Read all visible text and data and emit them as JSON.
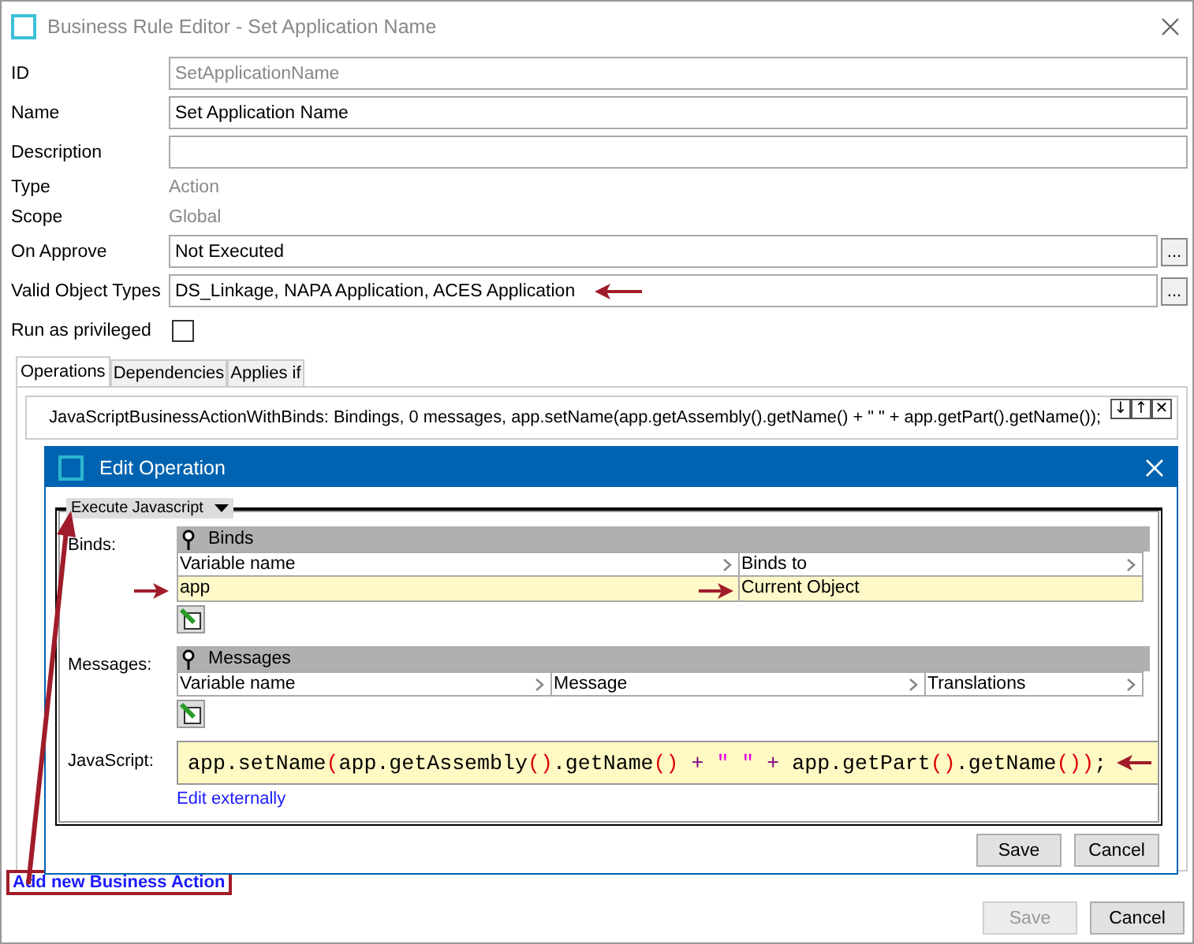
{
  "window": {
    "title": "Business Rule Editor - Set Application Name"
  },
  "fields": [
    {
      "label": "ID",
      "kind": "readonly",
      "value": "SetApplicationName"
    },
    {
      "label": "Name",
      "kind": "input",
      "value": "Set Application Name"
    },
    {
      "label": "Description",
      "kind": "input"
    },
    {
      "label": "Type",
      "kind": "text",
      "value": "Action"
    },
    {
      "label": "Scope",
      "kind": "text",
      "value": "Global"
    },
    {
      "label": "On Approve",
      "kind": "picker",
      "value": "Not Executed",
      "button": "..."
    },
    {
      "label": "Valid Object Types",
      "kind": "picker",
      "value": "DS_Linkage, NAPA Application, ACES Application",
      "button": "...",
      "annotated": true
    },
    {
      "label": "Run as privileged",
      "kind": "checkbox",
      "checked": false
    }
  ],
  "tabs": [
    {
      "label": "Operations",
      "selected": true
    },
    {
      "label": "Dependencies",
      "selected": false
    },
    {
      "label": "Applies if",
      "selected": false
    }
  ],
  "operation": {
    "text": "JavaScriptBusinessActionWithBinds: Bindings, 0 messages, app.setName(app.getAssembly().getName() + \" \" + app.getPart().getName());",
    "controls": [
      "↓",
      "↑",
      "✕"
    ]
  },
  "dialog": {
    "title": "Edit Operation",
    "type_dropdown": "Execute Javascript",
    "binds": {
      "label": "Binds:",
      "header": "Binds",
      "columns": [
        "Variable name",
        "Binds to"
      ],
      "rows": [
        {
          "cells": [
            "app",
            "Current Object"
          ],
          "selected": true,
          "annotated": true
        }
      ]
    },
    "messages": {
      "label": "Messages:",
      "header": "Messages",
      "columns": [
        "Variable name",
        "Message",
        "Translations"
      ]
    },
    "javascript": {
      "label": "JavaScript:",
      "annotated": true,
      "tokens": [
        {
          "text": "app.setName",
          "kind": "plain"
        },
        {
          "text": "(",
          "kind": "paren"
        },
        {
          "text": "app.getAssembly",
          "kind": "plain"
        },
        {
          "text": "()",
          "kind": "paren"
        },
        {
          "text": ".getName",
          "kind": "plain"
        },
        {
          "text": "()",
          "kind": "paren"
        },
        {
          "text": " + ",
          "kind": "op"
        },
        {
          "text": "\" \"",
          "kind": "string"
        },
        {
          "text": " + ",
          "kind": "op"
        },
        {
          "text": "app.getPart",
          "kind": "plain"
        },
        {
          "text": "()",
          "kind": "paren"
        },
        {
          "text": ".getName",
          "kind": "plain"
        },
        {
          "text": "())",
          "kind": "paren"
        },
        {
          "text": ";",
          "kind": "plain"
        }
      ]
    },
    "edit_link": "Edit externally",
    "buttons": [
      "Save",
      "Cancel"
    ]
  },
  "add_link": {
    "label": "Add new Business Action",
    "boxed": true
  },
  "buttons": [
    {
      "label": "Save",
      "disabled": true
    },
    {
      "label": "Cancel",
      "disabled": false
    }
  ]
}
